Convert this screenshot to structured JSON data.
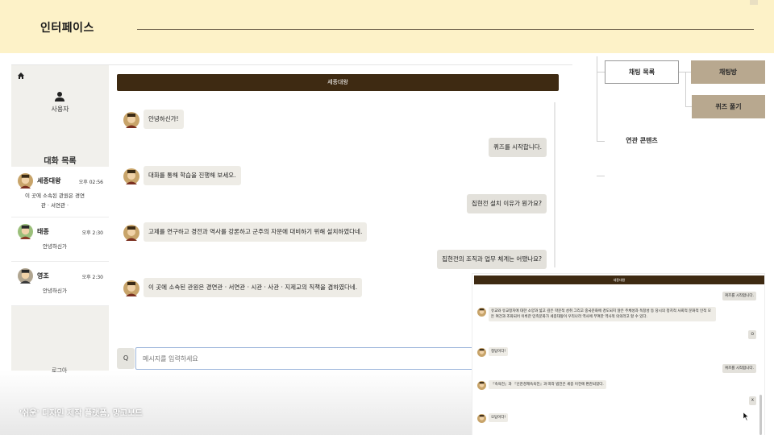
{
  "header": {
    "title": "인터페이스"
  },
  "sidebar": {
    "user_label": "사용자",
    "chatlist_title": "대화 목록",
    "items": [
      {
        "name": "세종대왕",
        "time": "오후 02:56",
        "preview": "이 곳에 소속된 관원은 경연관 · 서연관 ·"
      },
      {
        "name": "태종",
        "time": "오후 2:30",
        "preview": "안녕하신가"
      },
      {
        "name": "영조",
        "time": "오후 2:30",
        "preview": "안녕하신가"
      }
    ],
    "partial_label": "로그아"
  },
  "conversation": {
    "title": "세종대왕",
    "messages": [
      {
        "role": "bot",
        "text": "안녕하신가!"
      },
      {
        "role": "me",
        "text": "퀴즈를 시작합니다."
      },
      {
        "role": "bot",
        "text": "대화를 통해 학습을 진행해 보세오."
      },
      {
        "role": "me",
        "text": "집현전 설치 이유가 뭔가요?"
      },
      {
        "role": "bot",
        "text": "고제를 연구하고 경전과 역사를 강론하고 군주의 자문에 대비하기 위해 설치하였다네."
      },
      {
        "role": "me",
        "text": "집현전의 조직과 업무 체계는 어땠나요?"
      },
      {
        "role": "bot",
        "text": "이 곳에 소속된 관원은  경연관 · 서연관 · 시관 · 사관 · 지제교의 직책을 겸하였다네."
      }
    ],
    "search_label": "Q",
    "input_placeholder": "메시지를 입력하세요"
  },
  "diagram": {
    "chat_list": "채팅 목록",
    "chat_room": "채팅방",
    "quiz": "퀴즈 풀기",
    "related": "연관 콘텐츠"
  },
  "overlay": {
    "title": "세종대왕",
    "messages": [
      {
        "role": "me",
        "text": "퀴즈를 시작합니다."
      },
      {
        "role": "bot",
        "text": "유교와 유교정치에 대한 소양과 넓고 깊은 학문적 성취 그리고 중국문화에 경도되지 않은 주체성과 독창성 등 당시의 정치적 사회적 문화적 인적 모든 여건과 조화되어 이룩한 민족문화가 세종대왕이 우리나라 역사에 부여한 역사적 의의라고 할 수 있다."
      },
      {
        "role": "me",
        "text": "O"
      },
      {
        "role": "bot",
        "text": "정답이다!"
      },
      {
        "role": "me",
        "text": "퀴즈를 시작합니다."
      },
      {
        "role": "bot",
        "text": "『속육전』과 『신찬경제속육전』과 따라 법전은 세종 이전에 편찬되었다."
      },
      {
        "role": "me",
        "text": "X"
      },
      {
        "role": "bot",
        "text": "오답이다!"
      }
    ]
  },
  "caption": "'쉬운' 디자인 제작 플랫폼, 망고보드",
  "colors": {
    "header_bg": "#fdf2c8",
    "title_bar": "#3e2a12",
    "accent_box": "#b8a88f"
  }
}
